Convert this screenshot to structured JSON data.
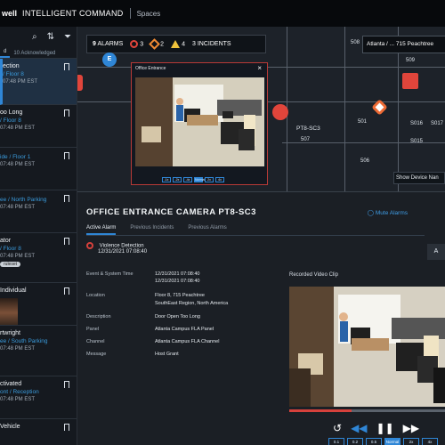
{
  "topbar": {
    "brand": "well",
    "product": "INTELLIGENT COMMAND",
    "page": "Spaces"
  },
  "sidebar": {
    "tabs": [
      "d",
      "10 Acknowledged"
    ],
    "tools": [
      "search-icon",
      "filter-icon",
      "funnel-icon"
    ],
    "alarms": [
      {
        "title": "ection",
        "location": "/ Floor 8",
        "time": "07:48 PM EST",
        "selected": true
      },
      {
        "title": "oo Long",
        "location": "/ Floor 8",
        "time": "07:48 PM EST"
      },
      {
        "title": "",
        "location": "ide / Floor 1",
        "time": "07:48 PM EST"
      },
      {
        "title": "",
        "location": "ee / North Parking",
        "time": "07:48 PM EST"
      },
      {
        "title": "ator",
        "location": "/ Floor 8",
        "time": "07:48 PM EST",
        "pill": "ruleset"
      },
      {
        "title": "Individual",
        "location": "",
        "time": ""
      },
      {
        "title": "rtwright",
        "location": "ee / South Parking",
        "time": "07:48 PM EST"
      },
      {
        "title": "ctivated",
        "location": "ont / Reception",
        "time": "07:48 PM EST"
      },
      {
        "title": "Vehicle",
        "location": "",
        "time": ""
      }
    ]
  },
  "map": {
    "summary": {
      "count": "9",
      "label": "ALARMS",
      "red": "3",
      "orange": "2",
      "yellow": "4",
      "incidents_count": "3",
      "incidents_label": "INCIDENTS"
    },
    "breadcrumb": "Atlanta / ... 715 Peachtree",
    "device_label": "PT8-SC3",
    "room_number": "507",
    "show_device_names": "Show Device Nan",
    "rooms": [
      "501",
      "506",
      "508",
      "509",
      "S016",
      "S015",
      "S017"
    ],
    "popup_title": "Office Entrance",
    "popup_controls": [
      "-1x",
      "-2x",
      "-4x",
      "Normal",
      "2x",
      "4x"
    ]
  },
  "detail": {
    "title": "OFFICE ENTRANCE CAMERA PT8-SC3",
    "mute": "Mute Alarms",
    "tabs": [
      "Active Alarm",
      "Previous Incidents",
      "Previous Alarms"
    ],
    "active_alarm": {
      "name": "Violence Detection",
      "time": "12/31/2021 07:08:40"
    },
    "fields": [
      {
        "label": "Event & System Time",
        "value": "12/31/2021 07:08:40",
        "value2": "12/31/2021 07:08:40"
      },
      {
        "label": "Location",
        "value": "Floor 8, 715 Peachtree",
        "value2": "SouthEast Region, North America"
      },
      {
        "label": "Description",
        "value": "Door Open Too Long",
        "value2": ""
      },
      {
        "label": "Panel",
        "value": "Atlanta Campus FLA Panel",
        "value2": ""
      },
      {
        "label": "Channel",
        "value": "Atlanta Campus FLA Channel",
        "value2": ""
      },
      {
        "label": "Message",
        "value": "Host Grant",
        "value2": ""
      }
    ],
    "clip_title": "Recorded Video Clip",
    "speed_buttons": [
      "0.1",
      "0.2",
      "0.5",
      "Normal",
      "2x",
      "4x"
    ]
  }
}
